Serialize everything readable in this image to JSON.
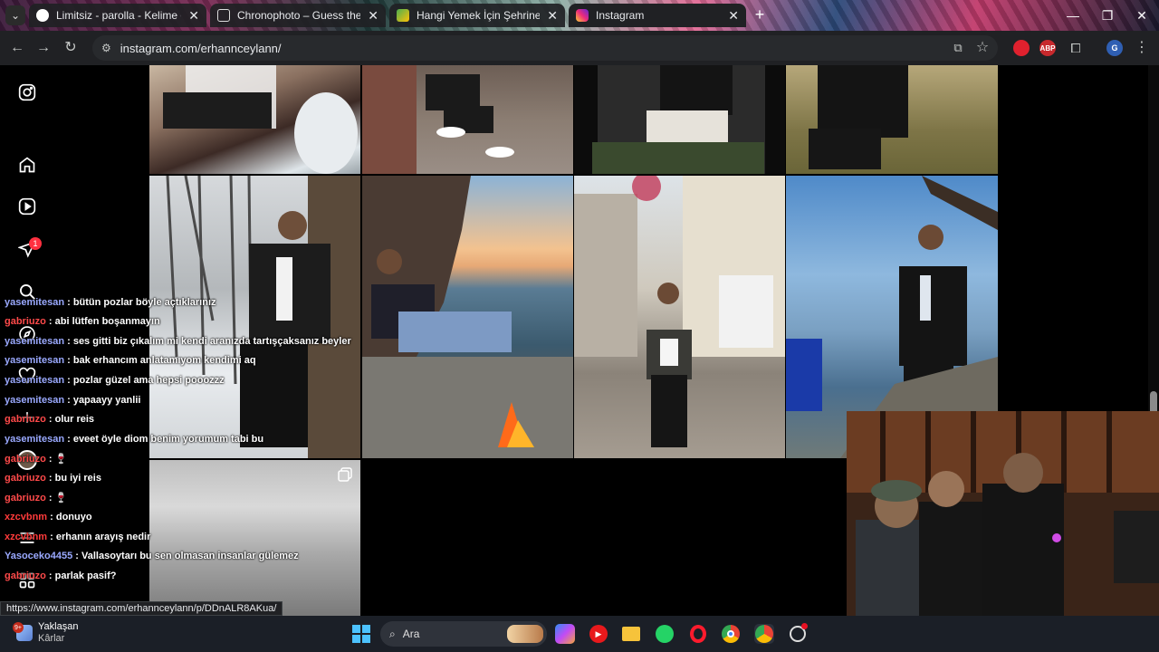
{
  "browser": {
    "tabs": [
      {
        "title": "Limitsiz - parolla - Kelime oyunu",
        "active": false
      },
      {
        "title": "Chronophoto – Guess the Year",
        "active": false
      },
      {
        "title": "Hangi Yemek İçin Şehrine Gider",
        "active": false
      },
      {
        "title": "Instagram",
        "active": true
      }
    ],
    "new_tab": "+",
    "url": "instagram.com/erhannceylann/",
    "status_url": "https://www.instagram.com/erhannceylann/p/DDnALR8AKua/",
    "extensions": [
      "ABP"
    ],
    "profile_initial": "G"
  },
  "instagram": {
    "nav": [
      "instagram-logo",
      "home",
      "reels",
      "messages",
      "search",
      "explore",
      "notifications",
      "create",
      "profile",
      "more",
      "also-from-meta"
    ],
    "messages_badge": "1"
  },
  "chat": [
    {
      "user": "yasemitesan",
      "text": " : bütün pozlar böyle açtıklarınız",
      "color": "#9aa9ff"
    },
    {
      "user": "gabriuzo",
      "text": " : abi lütfen boşanmayın",
      "color": "#ff4a4a"
    },
    {
      "user": "yasemitesan",
      "text": " : ses gitti biz çıkalım mi kendi aranızda tartışçaksanız beyler",
      "color": "#9aa9ff"
    },
    {
      "user": "yasemitesan",
      "text": " : bak erhancım anlatamıyom kendimi aq",
      "color": "#9aa9ff"
    },
    {
      "user": "yasemitesan",
      "text": " : pozlar güzel ama hepsi pooozzz",
      "color": "#9aa9ff"
    },
    {
      "user": "yasemitesan",
      "text": " : yapaayy yanlii",
      "color": "#9aa9ff"
    },
    {
      "user": "gabriuzo",
      "text": " : olur reis",
      "color": "#ff4a4a"
    },
    {
      "user": "yasemitesan",
      "text": " : eveet öyle diom benim yorumum tabi bu",
      "color": "#9aa9ff"
    },
    {
      "user": "gabriuzo",
      "text": " : 🍷",
      "color": "#ff4a4a"
    },
    {
      "user": "gabriuzo",
      "text": " : bu iyi reis",
      "color": "#ff4a4a"
    },
    {
      "user": "gabriuzo",
      "text": " : 🍷",
      "color": "#ff4a4a"
    },
    {
      "user": "xzcvbnm",
      "text": " : donuyo",
      "color": "#ff3b3b"
    },
    {
      "user": "xzcvbnm",
      "text": " : erhanın arayış nedir",
      "color": "#ff3b3b"
    },
    {
      "user": "Yasoceko4455",
      "text": " : Vallasoytarı bu sen olmasan insanlar gülemez",
      "color": "#9aa9ff"
    },
    {
      "user": "gabriuzo",
      "text": " : parlak pasif?",
      "color": "#ff4a4a"
    }
  ],
  "taskbar": {
    "weather_title": "Yaklaşan",
    "weather_sub": "Kârlar",
    "weather_badge": "9+",
    "search_placeholder": "Ara"
  }
}
